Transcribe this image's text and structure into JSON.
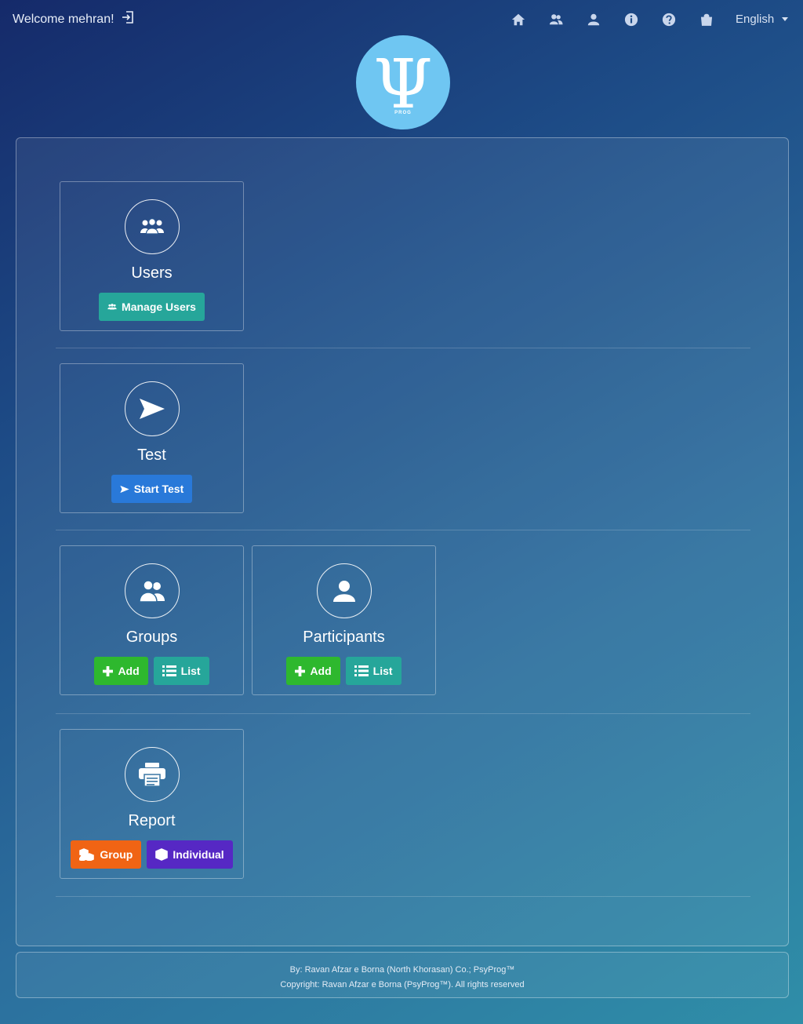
{
  "header": {
    "welcome_text": "Welcome mehran!",
    "nav_icons": [
      "home-icon",
      "users-icon",
      "user-icon",
      "info-icon",
      "help-icon",
      "shopping-bag-icon"
    ],
    "language": "English"
  },
  "logo": {
    "symbol": "Ψ",
    "subtext": "PROG",
    "color": "#6fc6f2"
  },
  "sections": {
    "users": {
      "title": "Users",
      "button": "Manage Users"
    },
    "test": {
      "title": "Test",
      "button": "Start Test"
    },
    "groups": {
      "title": "Groups",
      "add": "Add",
      "list": "List"
    },
    "participants": {
      "title": "Participants",
      "add": "Add",
      "list": "List"
    },
    "report": {
      "title": "Report",
      "group": "Group",
      "individual": "Individual"
    }
  },
  "colors": {
    "teal": "#26a69a",
    "blue": "#2979d9",
    "green": "#2eb82e",
    "orange": "#f06414",
    "purple": "#5628c4"
  },
  "footer": {
    "line1": "By: Ravan Afzar e Borna (North Khorasan) Co.; PsyProg™",
    "line2": "Copyright: Ravan Afzar e Borna (PsyProg™). All rights reserved"
  }
}
